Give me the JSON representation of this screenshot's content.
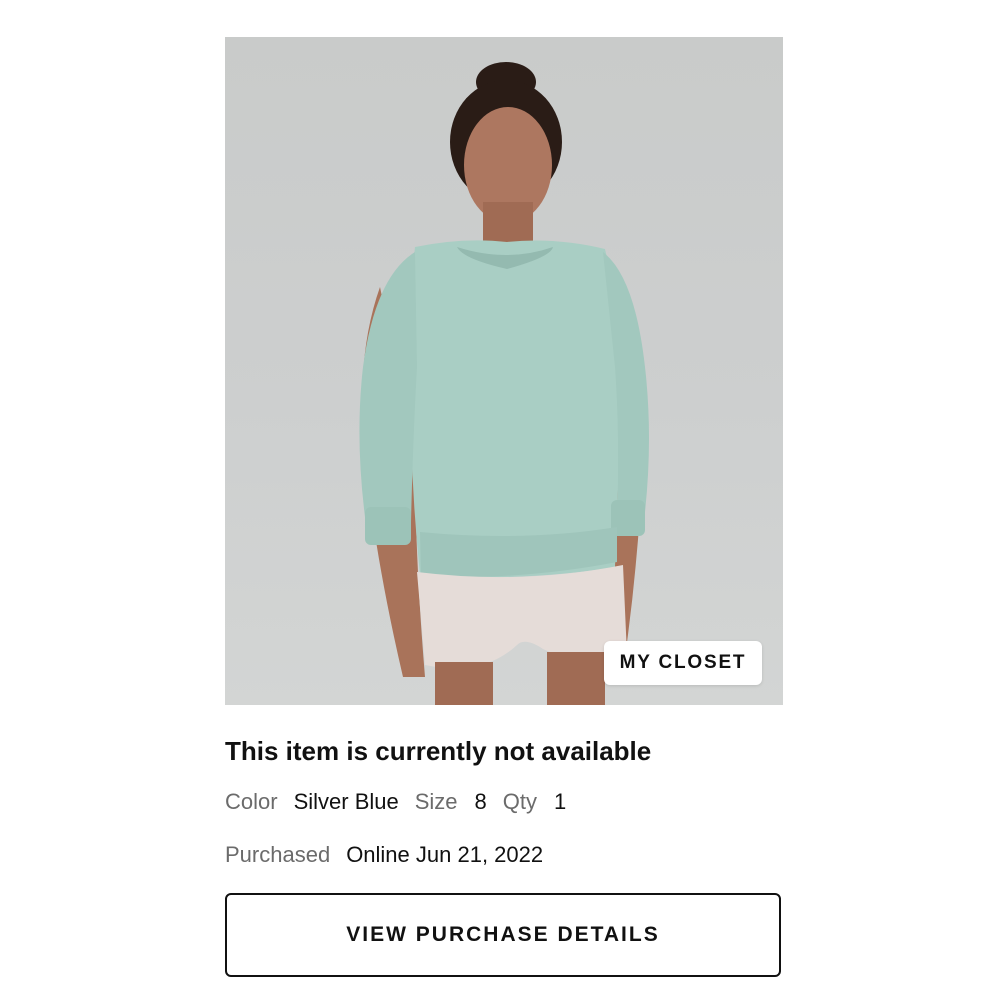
{
  "product": {
    "image_alt": "Woman wearing a silver blue crewneck sweatshirt and light shorts",
    "closet_badge": "MY CLOSET",
    "availability": "This item is currently not available",
    "color_label": "Color",
    "color_value": "Silver Blue",
    "size_label": "Size",
    "size_value": "8",
    "qty_label": "Qty",
    "qty_value": "1",
    "purchased_label": "Purchased",
    "purchased_value": "Online Jun 21, 2022"
  },
  "actions": {
    "view_details_label": "VIEW PURCHASE DETAILS"
  },
  "colors": {
    "sweatshirt": "#a9cec4",
    "background": "#cbcdcc",
    "shorts": "#e5dcd8",
    "skin": "#a9735a",
    "hair": "#2a1c16"
  }
}
